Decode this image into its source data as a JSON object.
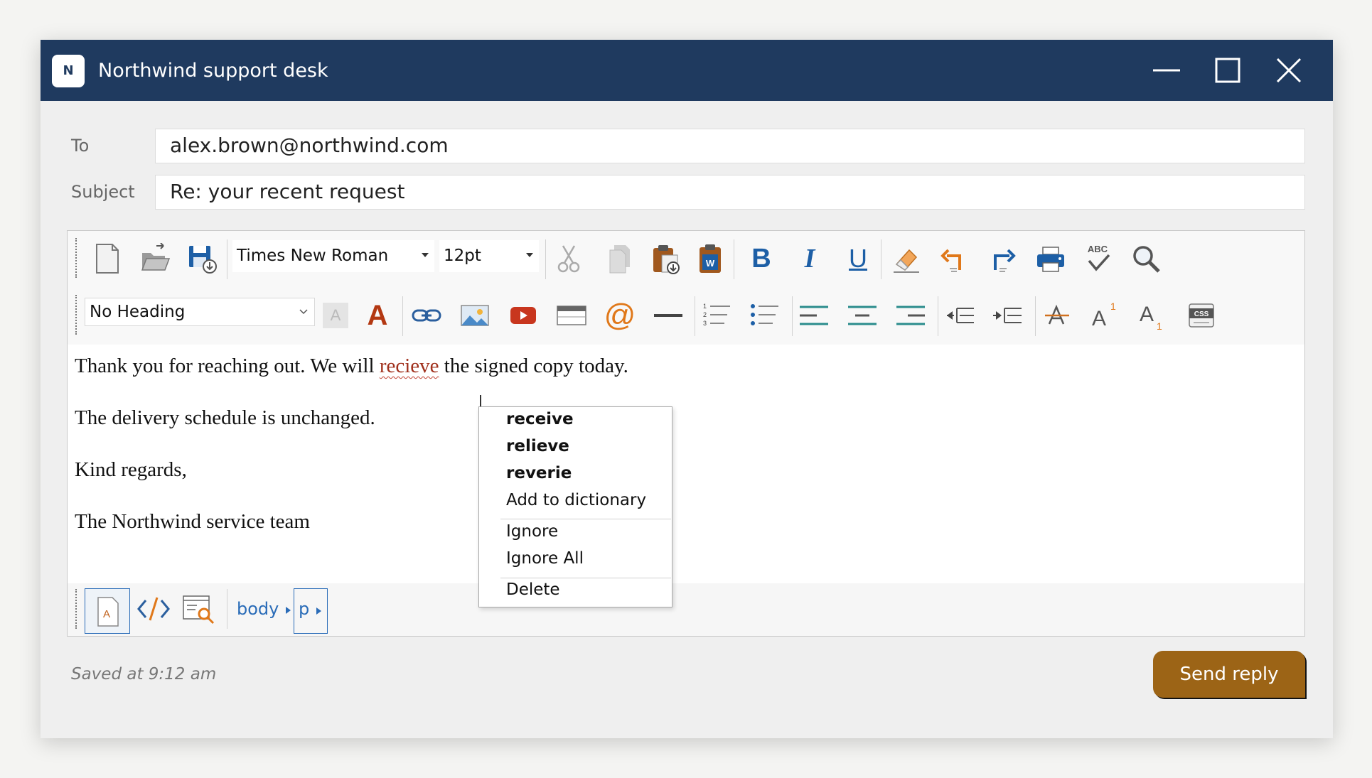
{
  "window": {
    "app_icon_letter": "N",
    "title": "Northwind support desk"
  },
  "compose": {
    "to_label": "To",
    "to_value": "alex.brown@northwind.com",
    "subject_label": "Subject",
    "subject_value": "Re: your recent request"
  },
  "toolbar": {
    "font_family": "Times New Roman",
    "font_size": "12pt",
    "heading": "No Heading",
    "icons_row1": [
      "new-document-icon",
      "open-folder-icon",
      "save-icon",
      "cut-icon",
      "copy-icon",
      "paste-icon",
      "paste-from-word-icon",
      "bold-icon",
      "italic-icon",
      "underline-icon",
      "eraser-icon",
      "undo-icon",
      "redo-icon",
      "print-icon",
      "spellcheck-icon",
      "search-icon"
    ],
    "icons_row2": [
      "background-color-icon",
      "font-color-icon",
      "link-icon",
      "image-icon",
      "video-icon",
      "table-icon",
      "at-sign-icon",
      "horizontal-rule-icon",
      "numbered-list-icon",
      "bulleted-list-icon",
      "align-left-icon",
      "align-center-icon",
      "align-right-icon",
      "outdent-icon",
      "indent-icon",
      "strikethrough-icon",
      "superscript-icon",
      "subscript-icon",
      "css-icon"
    ],
    "bold_glyph": "B",
    "italic_glyph": "I",
    "underline_glyph": "U",
    "spellcheck_glyph": "ABC",
    "font_color_glyph": "A",
    "bgcolor_glyph": "A",
    "at_glyph": "@",
    "superscript_glyph": "A",
    "superscript_mark": "1",
    "subscript_glyph": "A",
    "subscript_mark": "1",
    "css_glyph": "CSS",
    "paste_word_glyph": "W",
    "numbered_list_digits": [
      "1",
      "2",
      "3"
    ]
  },
  "body": {
    "line1_before": "Thank you for reaching out. We will ",
    "line1_misspelled": "recieve",
    "line1_after": " the signed copy today.",
    "line2": "The delivery schedule is unchanged.",
    "line3": "Kind regards,",
    "line4": "The Northwind service team"
  },
  "context_menu": {
    "suggestions": [
      "receive",
      "relieve",
      "reverie"
    ],
    "add_to_dictionary": "Add to dictionary",
    "ignore": "Ignore",
    "ignore_all": "Ignore All",
    "delete": "Delete"
  },
  "status": {
    "design_mode_glyph": "A",
    "breadcrumb": [
      "body",
      "p"
    ],
    "saved_text": "Saved at 9:12 am"
  },
  "actions": {
    "send_label": "Send reply"
  },
  "colors": {
    "titlebar": "#1f3a5f",
    "accent_blue": "#1d5fa6",
    "accent_orange": "#e0781a",
    "send_button": "#9c6416",
    "misspelled_text": "#a0301c"
  }
}
